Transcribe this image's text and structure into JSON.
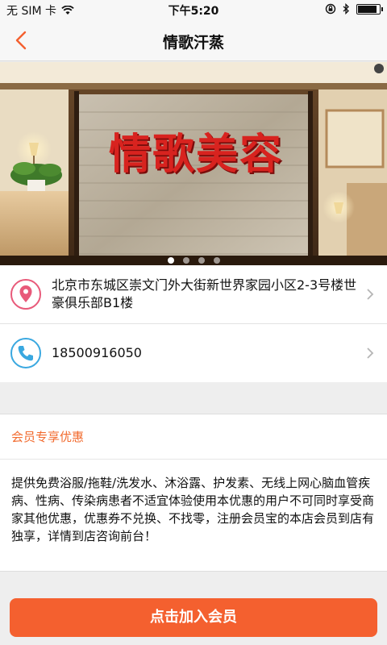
{
  "status_bar": {
    "carrier": "无 SIM 卡",
    "time": "下午5:20",
    "battery_level": 0.92
  },
  "nav": {
    "title": "情歌汗蒸",
    "back_icon": "chevron-left-icon"
  },
  "banner": {
    "sign_text": "情歌美容",
    "page_count": 4,
    "active_index": 0
  },
  "address": {
    "icon": "location-pin-icon",
    "text": "北京市东城区崇文门外大街新世界家园小区2-3号楼世豪俱乐部B1楼"
  },
  "phone": {
    "icon": "phone-icon",
    "number": "18500916050"
  },
  "promo": {
    "title": "会员专享优惠",
    "body": "提供免费浴服/拖鞋/洗发水、沐浴露、护发素、无线上网心脑血管疾病、性病、传染病患者不适宜体验使用本优惠的用户不可同时享受商家其他优惠，优惠券不兑换、不找零，注册会员宝的本店会员到店有独享，详情到店咨询前台！"
  },
  "join_button": {
    "label": "点击加入会员"
  },
  "colors": {
    "accent": "#f4602f",
    "promo_title": "#f26b2f",
    "pin_icon": "#e85a7a",
    "phone_icon": "#3aa8e0"
  }
}
